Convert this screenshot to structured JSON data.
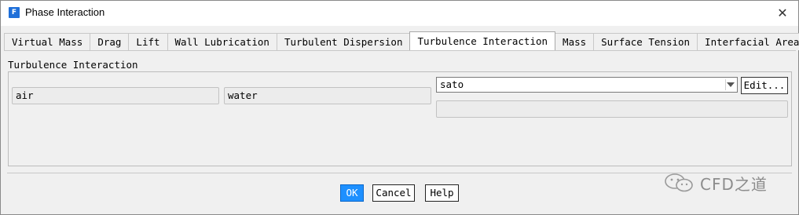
{
  "window": {
    "title": "Phase Interaction",
    "app_icon_letter": "F",
    "close_glyph": "✕"
  },
  "tabs": [
    {
      "label": "Virtual Mass",
      "active": false
    },
    {
      "label": "Drag",
      "active": false
    },
    {
      "label": "Lift",
      "active": false
    },
    {
      "label": "Wall Lubrication",
      "active": false
    },
    {
      "label": "Turbulent Dispersion",
      "active": false
    },
    {
      "label": "Turbulence Interaction",
      "active": true
    },
    {
      "label": "Mass",
      "active": false
    },
    {
      "label": "Surface Tension",
      "active": false
    },
    {
      "label": "Interfacial Area",
      "active": false
    }
  ],
  "panel": {
    "group_label": "Turbulence Interaction",
    "phase1": "air",
    "phase2": "water",
    "model_select": {
      "value": "sato"
    },
    "edit_button": "Edit..."
  },
  "footer": {
    "ok": "OK",
    "cancel": "Cancel",
    "help": "Help"
  },
  "watermark": {
    "text": "CFD之道",
    "icon": "wechat-icon"
  },
  "colors": {
    "accent": "#1e90ff",
    "window_bg": "#f0f0f0",
    "app_icon": "#1e6fd9"
  }
}
